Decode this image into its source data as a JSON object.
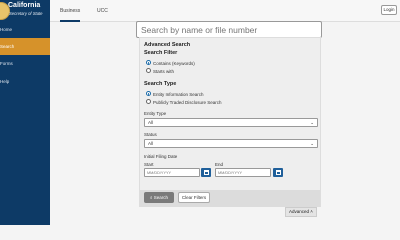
{
  "brand": {
    "title": "California",
    "subtitle": "Secretary of State"
  },
  "sidebar": {
    "items": [
      {
        "label": "Home"
      },
      {
        "label": "Search",
        "active": true
      },
      {
        "label": "Forms"
      },
      {
        "label": "Help"
      }
    ]
  },
  "tabs": [
    {
      "label": "Business",
      "active": true
    },
    {
      "label": "UCC"
    }
  ],
  "login": {
    "label": "Login"
  },
  "search": {
    "placeholder": "Search by name or file number"
  },
  "advanced": {
    "title": "Advanced Search",
    "search_filter": {
      "title": "Search Filter",
      "options": [
        "Contains (Keywords)",
        "Starts with"
      ],
      "selected": "Contains (Keywords)"
    },
    "search_type": {
      "title": "Search Type",
      "options": [
        "Entity Information Search",
        "Publicly Traded Disclosure Search"
      ],
      "selected": "Entity Information Search"
    },
    "entity_type": {
      "label": "Entity Type",
      "value": "All"
    },
    "status": {
      "label": "Status",
      "value": "All"
    },
    "filing_date": {
      "label": "Initial Filing Date",
      "start_label": "Start",
      "end_label": "End",
      "start_placeholder": "MM/DD/YYYY",
      "end_placeholder": "MM/DD/YYYY"
    },
    "search_button": "Search",
    "clear_button": "Clear Filters",
    "toggle_label": "Advanced ˄"
  },
  "colors": {
    "sidebar": "#0d3a66",
    "accent": "#d6922a",
    "primary": "#1f5f9a"
  }
}
